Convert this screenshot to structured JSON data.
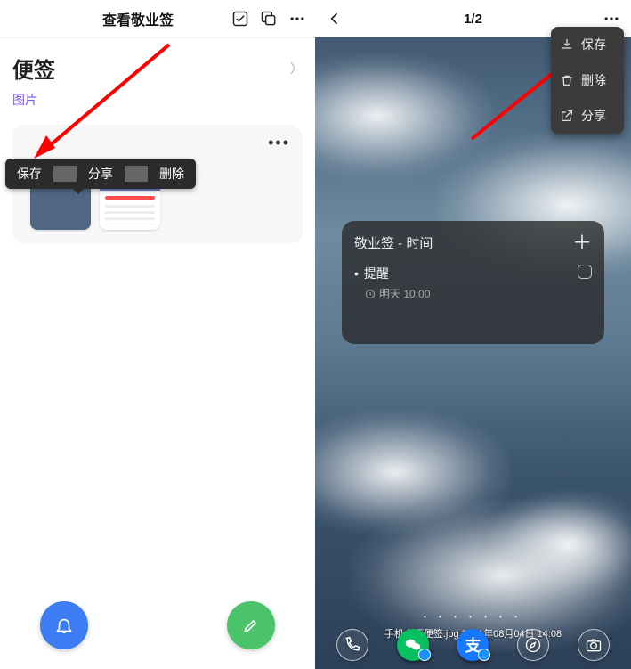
{
  "left": {
    "header": {
      "title": "查看敬业签"
    },
    "note": {
      "title": "便签",
      "subtitle": "图片"
    },
    "tip_menu": [
      "保存",
      "分享",
      "删除"
    ]
  },
  "right": {
    "header": {
      "counter": "1/2"
    },
    "dropdown": [
      {
        "key": "save",
        "label": "保存"
      },
      {
        "key": "delete",
        "label": "删除"
      },
      {
        "key": "share",
        "label": "分享"
      }
    ],
    "widget": {
      "title": "敬业签 - 时间",
      "reminder_title": "提醒",
      "reminder_time": "明天 10:00"
    },
    "footer_caption": "手机桌面便签.jpg  2021年08月04日  14:08"
  }
}
